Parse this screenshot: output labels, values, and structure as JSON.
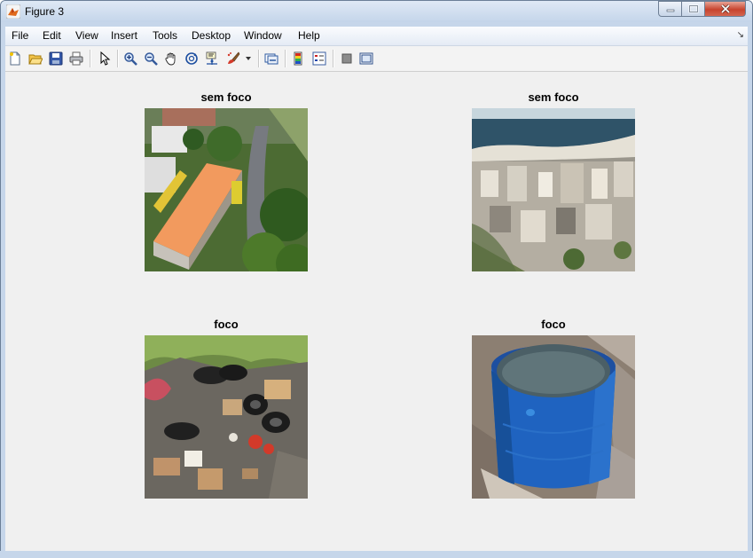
{
  "window": {
    "title": "Figure 3"
  },
  "menubar": {
    "items": [
      "File",
      "Edit",
      "View",
      "Insert",
      "Tools",
      "Desktop",
      "Window",
      "Help"
    ]
  },
  "toolbar": {
    "icons": [
      "new-figure-icon",
      "open-file-icon",
      "save-icon",
      "print-icon",
      "edit-plot-arrow-icon",
      "zoom-in-icon",
      "zoom-out-icon",
      "pan-hand-icon",
      "rotate-3d-icon",
      "data-cursor-icon",
      "brush-icon",
      "brush-dropdown-icon",
      "link-plot-icon",
      "insert-colorbar-icon",
      "insert-legend-icon",
      "hide-plot-tools-icon",
      "show-plot-tools-icon"
    ]
  },
  "axes": [
    {
      "title": "sem foco",
      "image": "aerial-orange-roof-building"
    },
    {
      "title": "sem foco",
      "image": "aerial-coastal-city"
    },
    {
      "title": "foco",
      "image": "tire-debris-pile"
    },
    {
      "title": "foco",
      "image": "blue-water-tank"
    }
  ]
}
